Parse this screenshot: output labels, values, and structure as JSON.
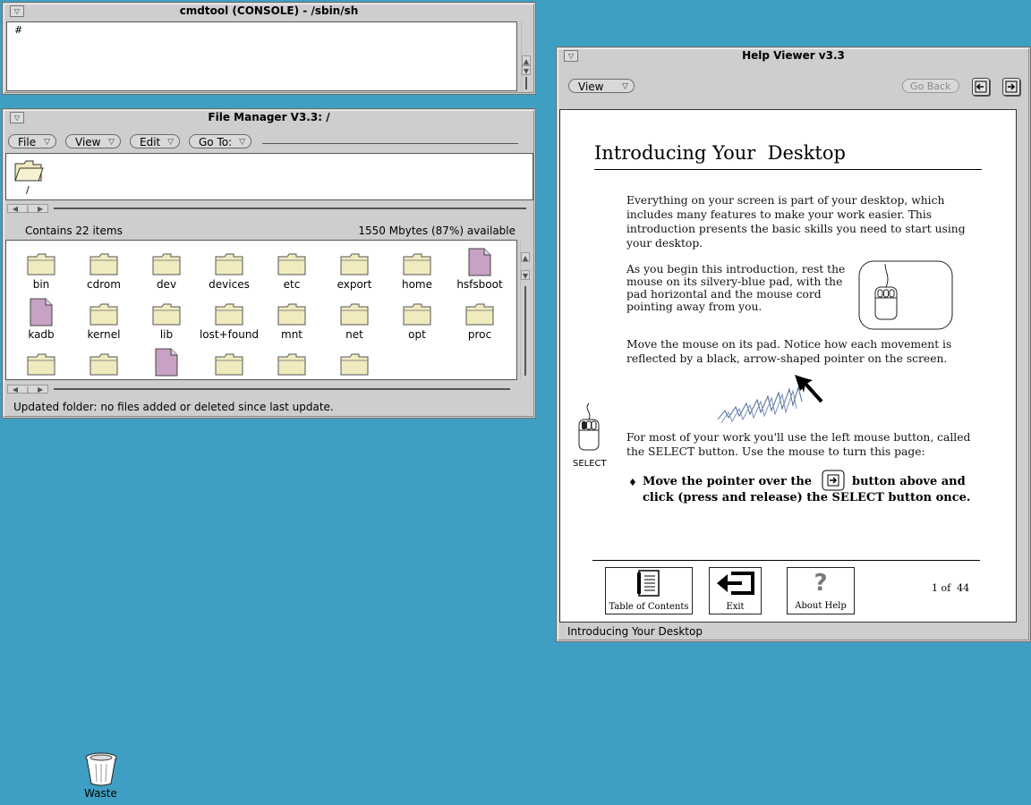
{
  "cmdtool": {
    "title": "cmdtool (CONSOLE) - /sbin/sh",
    "prompt": "#"
  },
  "file_manager": {
    "title": "File Manager V3.3: /",
    "menus": [
      "File",
      "View",
      "Edit",
      "Go To:"
    ],
    "path_label": "/",
    "item_count": "Contains 22 items",
    "disk_space": "1550 Mbytes (87%) available",
    "status": "Updated folder:  no files added or deleted since last update.",
    "items": [
      {
        "name": "bin",
        "type": "folder"
      },
      {
        "name": "cdrom",
        "type": "folder"
      },
      {
        "name": "dev",
        "type": "folder"
      },
      {
        "name": "devices",
        "type": "folder"
      },
      {
        "name": "etc",
        "type": "folder"
      },
      {
        "name": "export",
        "type": "folder"
      },
      {
        "name": "home",
        "type": "folder"
      },
      {
        "name": "hsfsboot",
        "type": "file"
      },
      {
        "name": "kadb",
        "type": "file"
      },
      {
        "name": "kernel",
        "type": "folder"
      },
      {
        "name": "lib",
        "type": "folder"
      },
      {
        "name": "lost+found",
        "type": "folder"
      },
      {
        "name": "mnt",
        "type": "folder"
      },
      {
        "name": "net",
        "type": "folder"
      },
      {
        "name": "opt",
        "type": "folder"
      },
      {
        "name": "proc",
        "type": "folder"
      },
      {
        "name": "",
        "type": "folder"
      },
      {
        "name": "",
        "type": "folder"
      },
      {
        "name": "",
        "type": "file"
      },
      {
        "name": "",
        "type": "folder"
      },
      {
        "name": "",
        "type": "folder"
      },
      {
        "name": "",
        "type": "folder"
      }
    ]
  },
  "help_viewer": {
    "title": "Help Viewer v3.3",
    "view_menu": "View",
    "go_back": "Go Back",
    "heading": "Introducing Your  Desktop",
    "para1": "Everything on your screen is part of your desktop, which includes many features to make your work easier. This introduction presents the basic skills you need to start using your desktop.",
    "para2": "As you begin this introduction, rest the mouse on its silvery-blue pad, with the pad horizontal and the mouse cord pointing away from you.",
    "para3": "Move the mouse on its pad. Notice how each movement is reflected by a black, arrow-shaped pointer on the screen.",
    "para4": "For most of your work you'll use the left mouse button, called the SELECT button. Use the mouse to turn this page:",
    "instruction_a": "Move the pointer over the",
    "instruction_b": "button above and",
    "instruction_c": "click (press and release) the SELECT button once.",
    "select_label": "SELECT",
    "toc_label": "Table of Contents",
    "exit_label": "Exit",
    "about_label": "About Help",
    "page_indicator": "1 of  44",
    "footer": "Introducing Your Desktop"
  },
  "desktop": {
    "waste_label": "Waste"
  },
  "colors": {
    "desktop": "#3f9fc2",
    "window": "#cecece",
    "folder": "#f0ebbf",
    "document": "#c7a2c4"
  }
}
